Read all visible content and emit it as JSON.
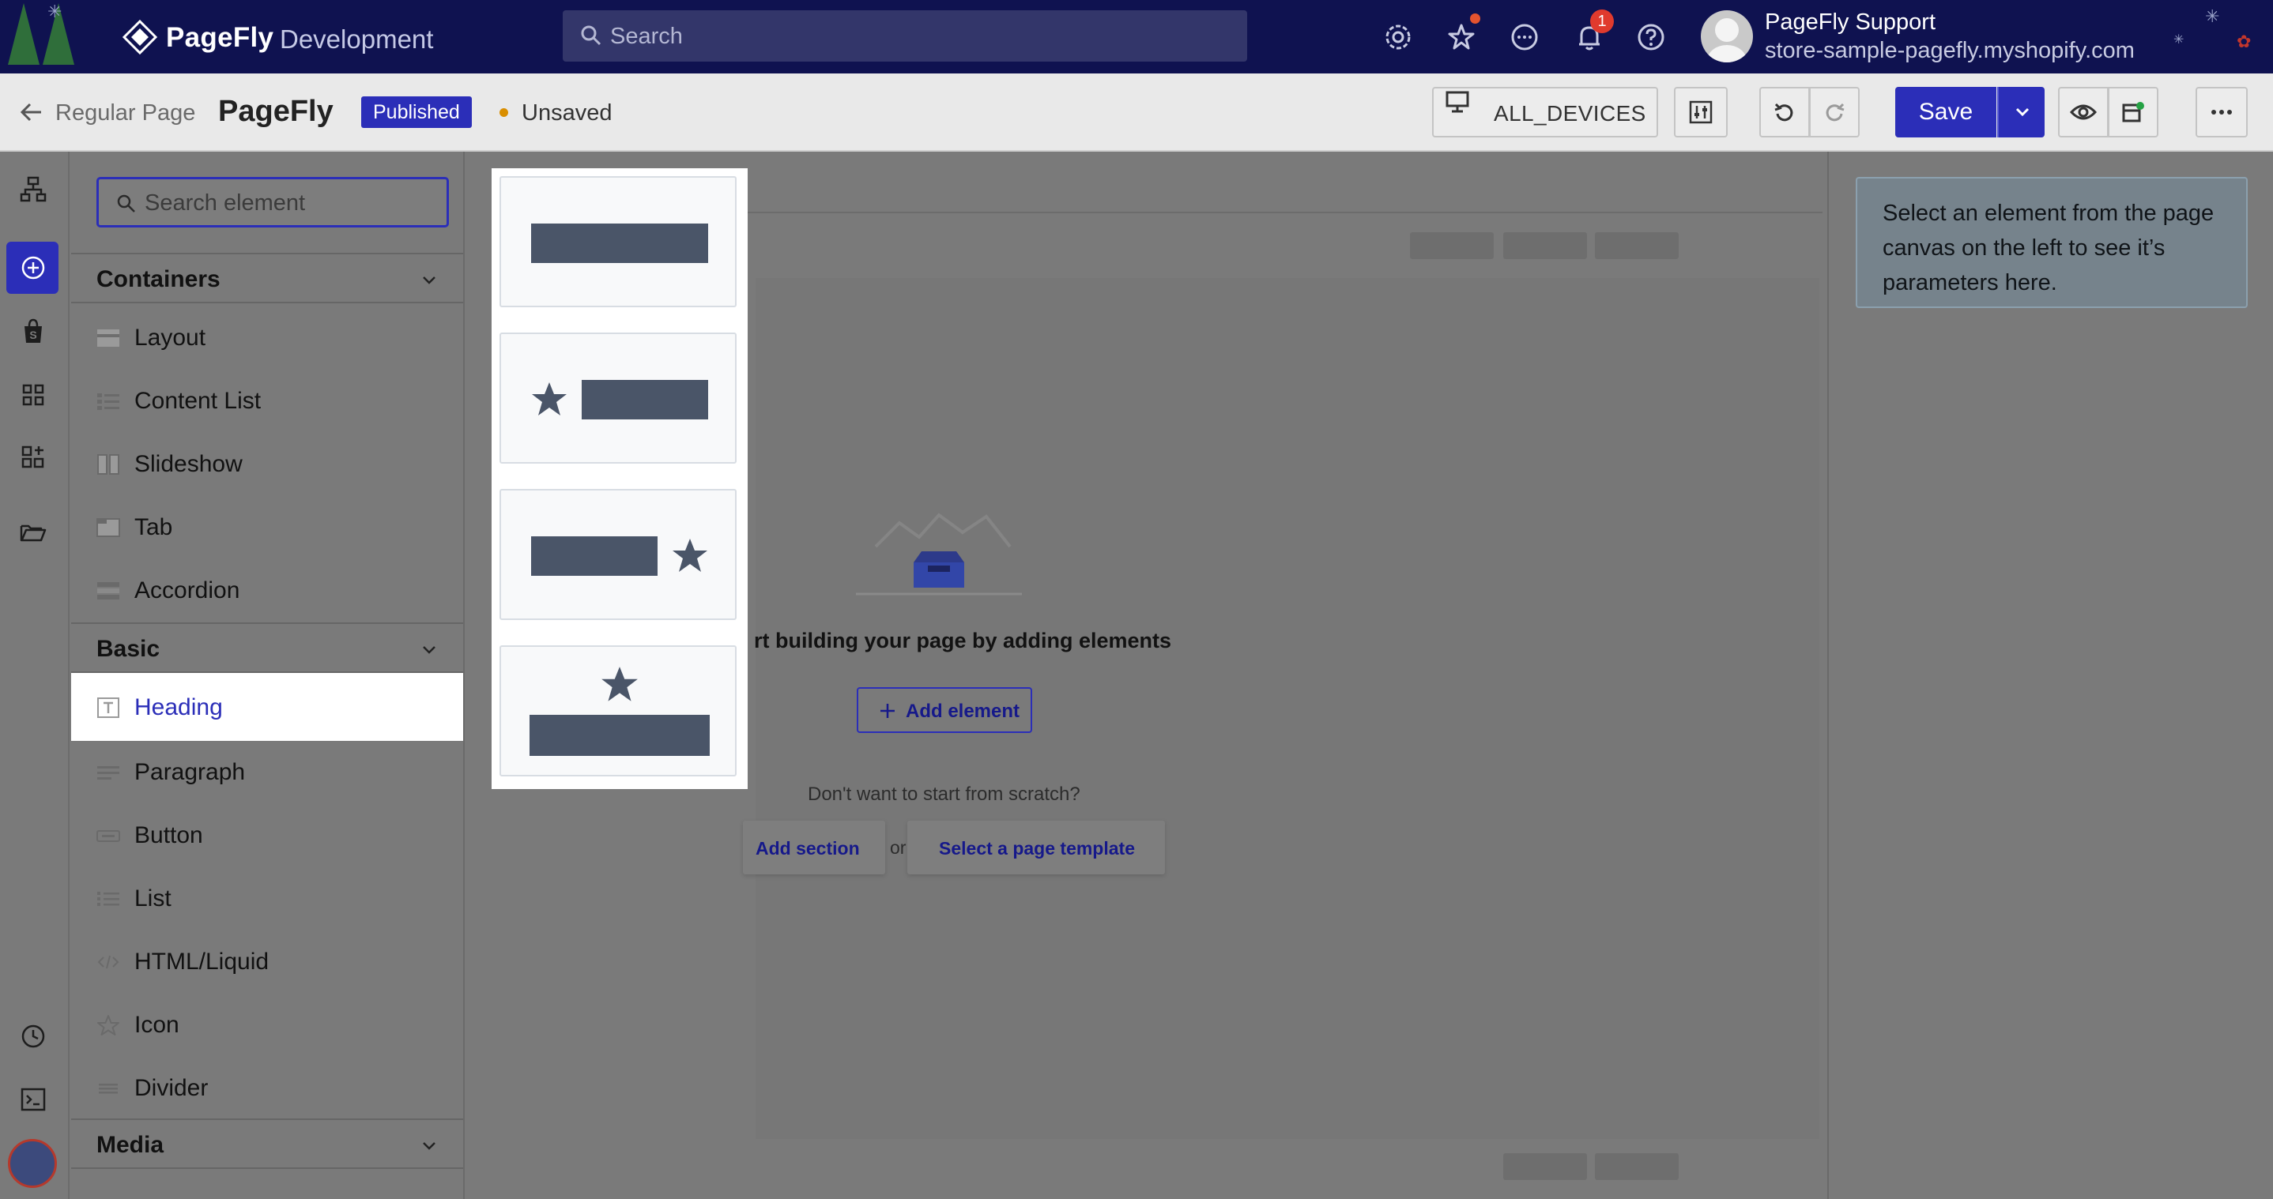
{
  "app": {
    "logo_name": "PageFly",
    "logo_sub": "Development",
    "search_placeholder": "Search",
    "notification_count": "1",
    "user_name": "PageFly Support",
    "user_store": "store-sample-pagefly.myshopify.com"
  },
  "toolbar": {
    "page_type": "Regular Page",
    "page_name": "PageFly",
    "status_badge": "Published",
    "save_state": "Unsaved",
    "devices_label": "ALL_DEVICES",
    "save_label": "Save"
  },
  "element_panel": {
    "search_placeholder": "Search element",
    "sections": [
      {
        "title": "Containers",
        "items": [
          "Layout",
          "Content List",
          "Slideshow",
          "Tab",
          "Accordion"
        ]
      },
      {
        "title": "Basic",
        "items": [
          "Heading",
          "Paragraph",
          "Button",
          "List",
          "HTML/Liquid",
          "Icon",
          "Divider"
        ]
      },
      {
        "title": "Media",
        "items": []
      }
    ],
    "active_item": "Heading"
  },
  "canvas": {
    "start_text": "rt building your page by adding elements",
    "add_element_label": "Add element",
    "scratch_text": "Don't want to start from scratch?",
    "add_section_label": "Add section",
    "or_text": "or",
    "select_template_label": "Select a page template"
  },
  "right_panel": {
    "info_text": "Select an element from the page canvas on the left to see it’s parameters here."
  },
  "colors": {
    "primary": "#2b2eb8",
    "topbar": "#0f1250",
    "variant_bar": "#4a5568"
  }
}
